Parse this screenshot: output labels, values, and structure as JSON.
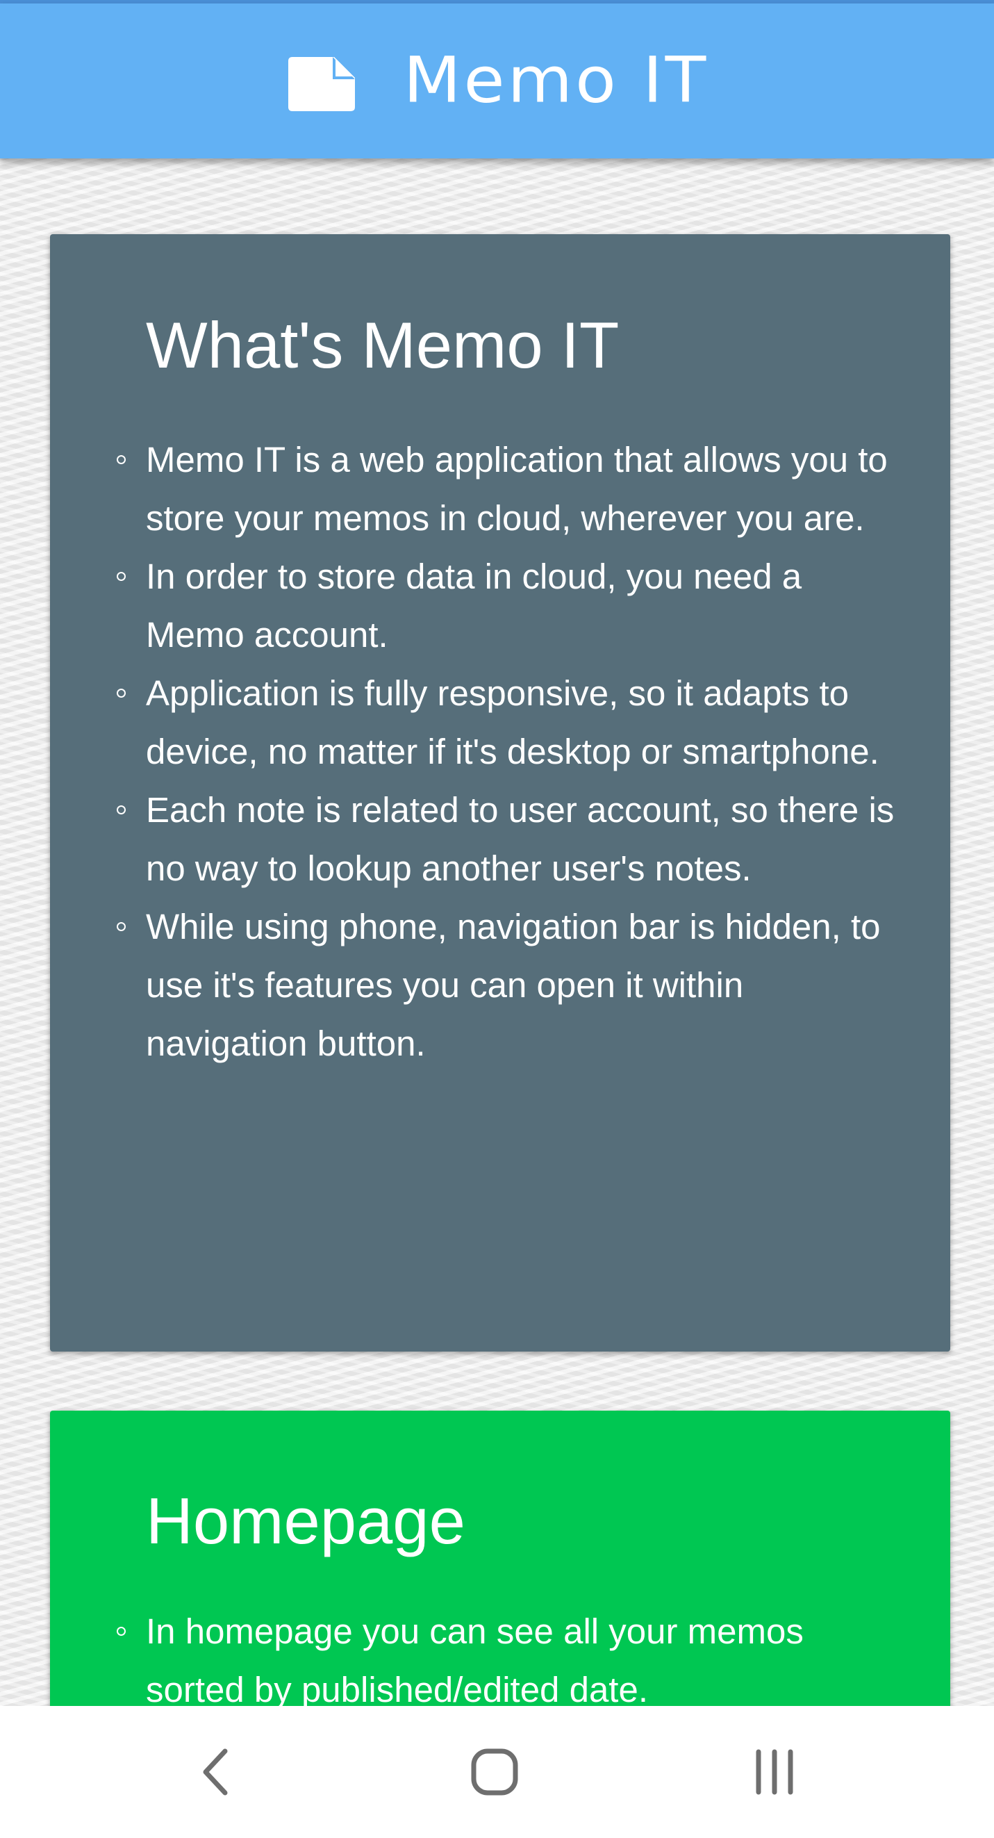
{
  "header": {
    "title": "Memo IT",
    "icon": "note-icon",
    "background": "#62b1f4"
  },
  "cards": [
    {
      "title": "What's Memo IT",
      "background": "#566e7a",
      "items": [
        "Memo IT is a web application that allows you to store your memos in cloud, wherever you are.",
        "In order to store data in cloud, you need a Memo account.",
        "Application is fully responsive, so it adapts to device, no matter if it's desktop or smartphone.",
        "Each note is related to user account, so there is no way to lookup another user's notes.",
        "While using phone, navigation bar is hidden, to use it's features you can open it within navigation button."
      ]
    },
    {
      "title": "Homepage",
      "background": "#00c752",
      "items": [
        "In homepage you can see all your memos sorted by published/edited date."
      ]
    }
  ],
  "system_nav": {
    "back": "back-icon",
    "home": "home-icon",
    "recents": "recents-icon"
  }
}
